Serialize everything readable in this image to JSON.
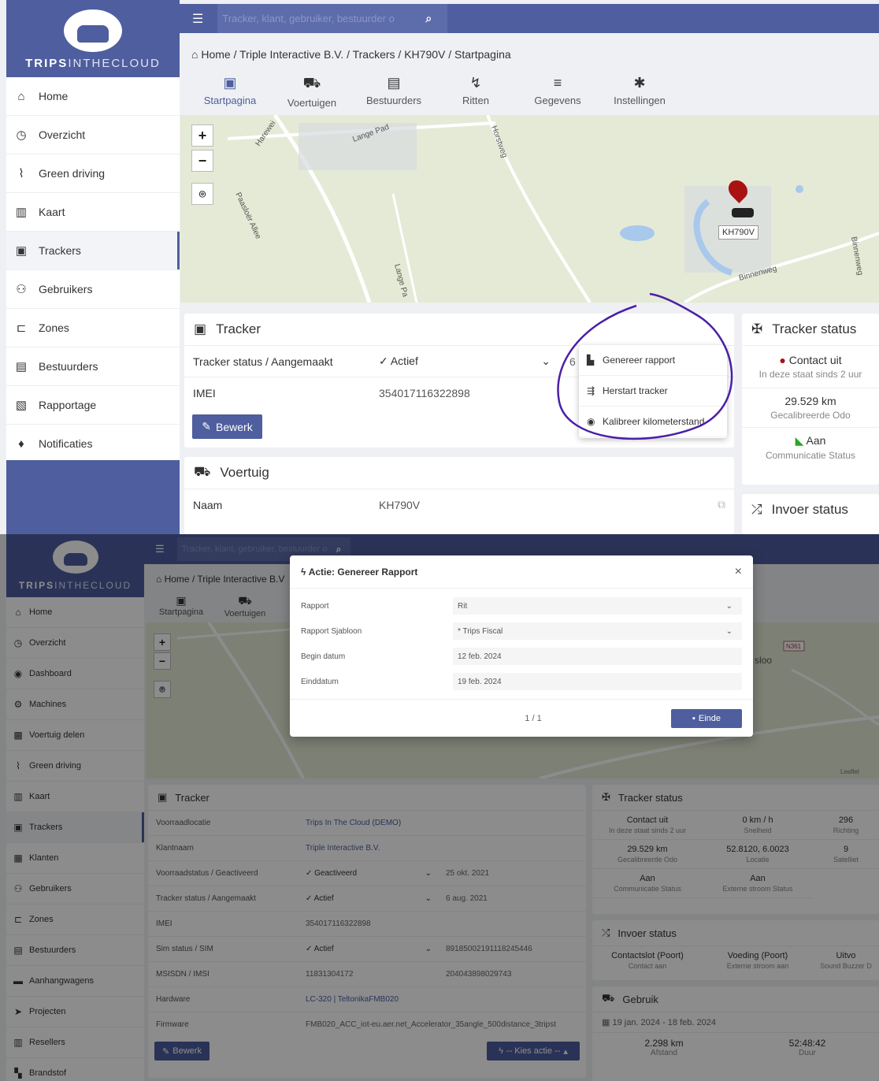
{
  "app": {
    "brand_bold": "TRIPS",
    "brand_light": "INTHECLOUD",
    "search_placeholder": "Tracker, klant, gebruiker, bestuurder o",
    "menu_icon": "bars-icon",
    "search_icon": "search-icon"
  },
  "shot1": {
    "sidebar": [
      {
        "label": "Home",
        "icon": "home-icon",
        "glyph": "⌂"
      },
      {
        "label": "Overzicht",
        "icon": "dashboard-icon",
        "glyph": "◷"
      },
      {
        "label": "Green driving",
        "icon": "driving-icon",
        "glyph": "⌇"
      },
      {
        "label": "Kaart",
        "icon": "map-icon",
        "glyph": "▥"
      },
      {
        "label": "Trackers",
        "icon": "chip-icon",
        "glyph": "▣",
        "active": true
      },
      {
        "label": "Gebruikers",
        "icon": "users-icon",
        "glyph": "⚇"
      },
      {
        "label": "Zones",
        "icon": "zones-icon",
        "glyph": "⊏"
      },
      {
        "label": "Bestuurders",
        "icon": "id-badge-icon",
        "glyph": "▤"
      },
      {
        "label": "Rapportage",
        "icon": "report-icon",
        "glyph": "▧"
      },
      {
        "label": "Notificaties",
        "icon": "bell-icon",
        "glyph": "♦"
      }
    ],
    "breadcrumb": [
      "Home",
      "Triple Interactive B.V.",
      "Trackers",
      "KH790V",
      "Startpagina"
    ],
    "breadcrumb_sep": "/",
    "tabs": [
      {
        "label": "Startpagina",
        "icon": "chip-icon",
        "glyph": "▣",
        "active": true
      },
      {
        "label": "Voertuigen",
        "icon": "cars-icon",
        "glyph": "⛟"
      },
      {
        "label": "Bestuurders",
        "icon": "id-badge-icon",
        "glyph": "▤"
      },
      {
        "label": "Ritten",
        "icon": "route-icon",
        "glyph": "↯"
      },
      {
        "label": "Gegevens",
        "icon": "database-icon",
        "glyph": "≡"
      },
      {
        "label": "Instellingen",
        "icon": "gear-icon",
        "glyph": "✱"
      }
    ],
    "map": {
      "zoom_in": "+",
      "zoom_out": "−",
      "fit_glyph": "⌾",
      "marker_label": "KH790V",
      "streets": [
        "Harewei",
        "Lange Pad",
        "Horstweg",
        "Paasloër Allee",
        "Lange Pa",
        "Binnenweg",
        "Binnenweg"
      ]
    },
    "tracker": {
      "title": "Tracker",
      "rows": [
        {
          "label": "Tracker status / Aangemaakt",
          "value": "✓ Actief",
          "extra": "6 a"
        },
        {
          "label": "IMEI",
          "value": "354017116322898"
        }
      ],
      "edit": "Bewerk"
    },
    "actions": [
      {
        "label": "Genereer rapport",
        "icon": "report-icon",
        "glyph": "▙"
      },
      {
        "label": "Herstart tracker",
        "icon": "restart-icon",
        "glyph": "⇶"
      },
      {
        "label": "Kalibreer kilometerstand",
        "icon": "gauge-icon",
        "glyph": "◉"
      }
    ],
    "vehicle": {
      "title": "Voertuig",
      "rows": [
        {
          "label": "Naam",
          "value": "KH790V"
        }
      ]
    },
    "status": {
      "title": "Tracker status",
      "items": [
        {
          "value": "Contact uit",
          "sub": "In deze staat sinds 2 uur"
        },
        {
          "value": "29.529 km",
          "sub": "Gecalibreerde Odo"
        },
        {
          "value": "Aan",
          "sub": "Communicatie Status"
        }
      ]
    },
    "invoer": {
      "title": "Invoer status"
    }
  },
  "shot2": {
    "sidebar": [
      {
        "label": "Home",
        "icon": "home-icon",
        "glyph": "⌂"
      },
      {
        "label": "Overzicht",
        "icon": "dashboard-icon",
        "glyph": "◷"
      },
      {
        "label": "Dashboard",
        "icon": "dashboard-icon",
        "glyph": "◉"
      },
      {
        "label": "Machines",
        "icon": "machine-icon",
        "glyph": "⚙"
      },
      {
        "label": "Voertuig delen",
        "icon": "car-share-icon",
        "glyph": "▩"
      },
      {
        "label": "Green driving",
        "icon": "driving-icon",
        "glyph": "⌇"
      },
      {
        "label": "Kaart",
        "icon": "map-icon",
        "glyph": "▥"
      },
      {
        "label": "Trackers",
        "icon": "chip-icon",
        "glyph": "▣",
        "active": true
      },
      {
        "label": "Klanten",
        "icon": "building-icon",
        "glyph": "▦"
      },
      {
        "label": "Gebruikers",
        "icon": "users-icon",
        "glyph": "⚇"
      },
      {
        "label": "Zones",
        "icon": "zones-icon",
        "glyph": "⊏"
      },
      {
        "label": "Bestuurders",
        "icon": "id-badge-icon",
        "glyph": "▤"
      },
      {
        "label": "Aanhangwagens",
        "icon": "trailer-icon",
        "glyph": "▬"
      },
      {
        "label": "Projecten",
        "icon": "project-icon",
        "glyph": "➤"
      },
      {
        "label": "Resellers",
        "icon": "reseller-icon",
        "glyph": "▥"
      },
      {
        "label": "Brandstof",
        "icon": "fuel-icon",
        "glyph": "▚"
      }
    ],
    "breadcrumb": [
      "Home",
      "Triple Interactive B.V"
    ],
    "tabs": [
      {
        "label": "Startpagina",
        "glyph": "▣"
      },
      {
        "label": "Voertuigen",
        "glyph": "⛟"
      }
    ],
    "modal": {
      "title": "Actie: Genereer Rapport",
      "close": "×",
      "rows": [
        {
          "label": "Rapport",
          "value": "Rit",
          "select": true
        },
        {
          "label": "Rapport Sjabloon",
          "value": "* Trips Fiscal",
          "select": true
        },
        {
          "label": "Begin datum",
          "value": "12 feb. 2024"
        },
        {
          "label": "Einddatum",
          "value": "19 feb. 2024"
        }
      ],
      "pager": "1 / 1",
      "finish": "Einde"
    },
    "map": {
      "label1": "sloo",
      "label2": "N361",
      "attribution": "Leaflet"
    },
    "tracker": {
      "title": "Tracker",
      "rows": [
        {
          "label": "Voorraadlocatie",
          "value": "Trips In The Cloud (DEMO)",
          "link": true
        },
        {
          "label": "Klantnaam",
          "value": "Triple Interactive B.V.",
          "link": true
        },
        {
          "label": "Voorraadstatus / Geactiveerd",
          "value": "✓ Geactiveerd",
          "extra": "25 okt. 2021",
          "select": true
        },
        {
          "label": "Tracker status / Aangemaakt",
          "value": "✓ Actief",
          "extra": "6 aug. 2021",
          "select": true
        },
        {
          "label": "IMEI",
          "value": "354017116322898"
        },
        {
          "label": "Sim status / SIM",
          "value": "✓ Actief",
          "extra": "89185002191118245446",
          "select": true
        },
        {
          "label": "MSISDN / IMSI",
          "value": "11831304172",
          "extra": "204043898029743"
        },
        {
          "label": "Hardware",
          "value": "LC-320 | TeltonikaFMB020",
          "link": true
        },
        {
          "label": "Firmware",
          "value": "FMB020_ACC_iot-eu.aer.net_Accelerator_35angle_500distance_3tripst"
        }
      ],
      "edit": "Bewerk",
      "action": "-- Kies actie --"
    },
    "status": {
      "title": "Tracker status",
      "grid": [
        {
          "value": "Contact uit",
          "sub": "In deze staat sinds 2 uur"
        },
        {
          "value": "0 km / h",
          "sub": "Snelheid"
        },
        {
          "value": "296",
          "sub": "Richting"
        },
        {
          "value": "29.529 km",
          "sub": "Gecalibreerde Odo"
        },
        {
          "value": "52.8120, 6.0023",
          "sub": "Locatie"
        },
        {
          "value": "9",
          "sub": "Satelliet"
        },
        {
          "value": "Aan",
          "sub": "Communicatie Status"
        },
        {
          "value": "Aan",
          "sub": "Externe stroom Status"
        }
      ]
    },
    "invoer": {
      "title": "Invoer status",
      "items": [
        {
          "value": "Contactslot (Poort)",
          "sub": "Contact aan"
        },
        {
          "value": "Voeding (Poort)",
          "sub": "Externe stroom aan"
        },
        {
          "value": "Uitvo",
          "sub": "Sound Buzzer D"
        }
      ]
    },
    "usage": {
      "title": "Gebruik",
      "period": "19 jan. 2024 - 18 feb. 2024",
      "items": [
        {
          "value": "2.298 km",
          "sub": "Afstand"
        },
        {
          "value": "52:48:42",
          "sub": "Duur"
        }
      ]
    }
  }
}
